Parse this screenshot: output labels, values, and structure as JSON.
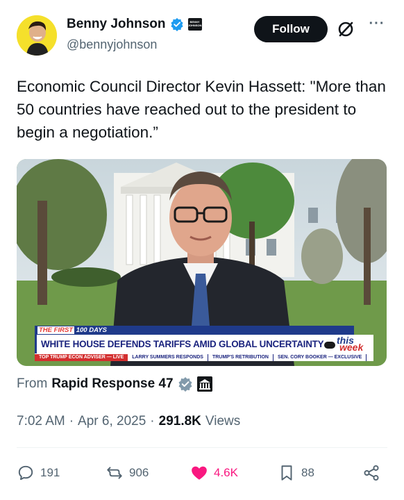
{
  "author": {
    "display_name": "Benny Johnson",
    "handle": "@bennyjohnson",
    "affiliate_badge_text": "BENNY JOHNSON"
  },
  "header": {
    "follow_label": "Follow",
    "more_label": "···"
  },
  "tweet": {
    "text": "Economic Council Director Kevin Hassett: \"More than 50 countries have reached out to the president to begin a negotiation.”"
  },
  "media": {
    "banner_top_prefix": "THE FIRST",
    "banner_top_suffix": "100 DAYS",
    "headline": "WHITE HOUSE DEFENDS TARIFFS AMID GLOBAL UNCERTAINTY",
    "logo_top": "this",
    "logo_bottom": "week",
    "ticker": [
      "TOP TRUMP ECON ADVISER — LIVE",
      "LARRY SUMMERS RESPONDS",
      "TRUMP'S RETRIBUTION",
      "SEN. CORY BOOKER — EXCLUSIVE"
    ]
  },
  "source": {
    "prefix": "From",
    "name": "Rapid Response 47"
  },
  "meta": {
    "time": "7:02 AM",
    "sep1": "·",
    "date": "Apr 6, 2025",
    "sep2": "·",
    "views_count": "291.8K",
    "views_label": "Views"
  },
  "actions": {
    "replies": "191",
    "reposts": "906",
    "likes": "4.6K",
    "bookmarks": "88"
  },
  "colors": {
    "brand_blue": "#1d9bf0",
    "like_pink": "#f91880",
    "text_primary": "#0f1419",
    "text_secondary": "#536471"
  }
}
